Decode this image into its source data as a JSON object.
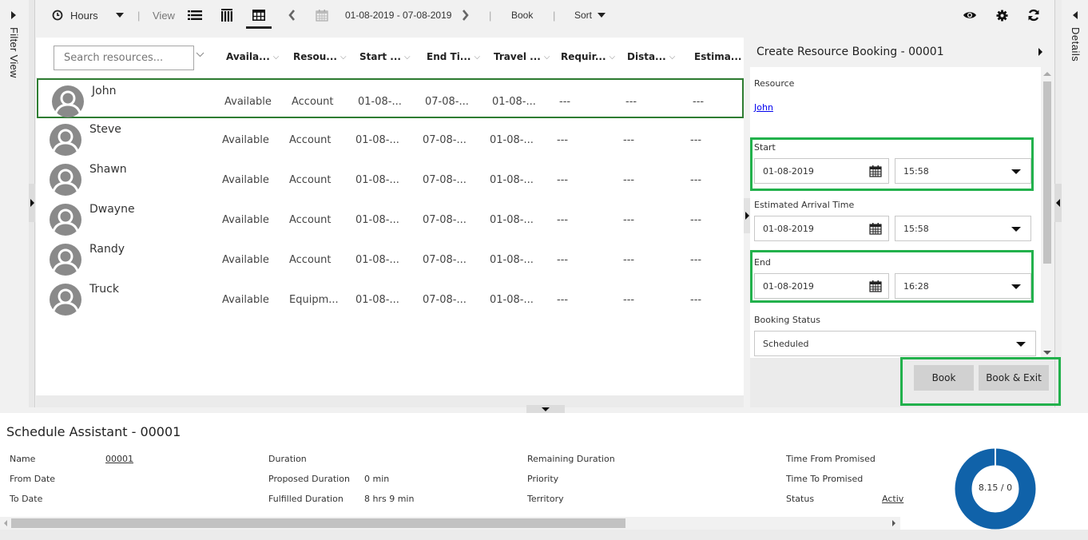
{
  "left_rail": {
    "label": "Filter View"
  },
  "right_rail": {
    "label": "Details"
  },
  "toolbar": {
    "time_scale": "Hours",
    "view_label": "View",
    "date_range": "01-08-2019 - 07-08-2019",
    "book_label": "Book",
    "sort_label": "Sort",
    "active_view": "grid"
  },
  "grid": {
    "search_placeholder": "Search resources...",
    "columns": [
      "Availa...",
      "Resou...",
      "Start ...",
      "End Ti...",
      "Travel ...",
      "Requir...",
      "Dista...",
      "Estima..."
    ],
    "rows": [
      {
        "name": "John",
        "availability": "Available",
        "resource_type": "Account",
        "start": "01-08-...",
        "end": "07-08-...",
        "travel": "01-08-...",
        "required": "---",
        "distance": "---",
        "estimated": "---",
        "selected": true
      },
      {
        "name": "Steve",
        "availability": "Available",
        "resource_type": "Account",
        "start": "01-08-...",
        "end": "07-08-...",
        "travel": "01-08-...",
        "required": "---",
        "distance": "---",
        "estimated": "---",
        "selected": false
      },
      {
        "name": "Shawn",
        "availability": "Available",
        "resource_type": "Account",
        "start": "01-08-...",
        "end": "07-08-...",
        "travel": "01-08-...",
        "required": "---",
        "distance": "---",
        "estimated": "---",
        "selected": false
      },
      {
        "name": "Dwayne",
        "availability": "Available",
        "resource_type": "Account",
        "start": "01-08-...",
        "end": "07-08-...",
        "travel": "01-08-...",
        "required": "---",
        "distance": "---",
        "estimated": "---",
        "selected": false
      },
      {
        "name": "Randy",
        "availability": "Available",
        "resource_type": "Account",
        "start": "01-08-...",
        "end": "07-08-...",
        "travel": "01-08-...",
        "required": "---",
        "distance": "---",
        "estimated": "---",
        "selected": false
      },
      {
        "name": "Truck",
        "availability": "Available",
        "resource_type": "Equipm...",
        "start": "01-08-...",
        "end": "07-08-...",
        "travel": "01-08-...",
        "required": "---",
        "distance": "---",
        "estimated": "---",
        "selected": false
      }
    ]
  },
  "booking": {
    "title": "Create Resource Booking - 00001",
    "resource_label": "Resource",
    "resource_value": "John",
    "start_label": "Start",
    "start_date": "01-08-2019",
    "start_time": "15:58",
    "eta_label": "Estimated Arrival Time",
    "eta_date": "01-08-2019",
    "eta_time": "15:58",
    "end_label": "End",
    "end_date": "01-08-2019",
    "end_time": "16:28",
    "status_label": "Booking Status",
    "status_value": "Scheduled",
    "book_button": "Book",
    "book_exit_button": "Book & Exit"
  },
  "schedule_assistant": {
    "title": "Schedule Assistant - 00001",
    "fields": {
      "name_label": "Name",
      "name_value": "00001",
      "from_date_label": "From Date",
      "to_date_label": "To Date",
      "duration_label": "Duration",
      "proposed_duration_label": "Proposed Duration",
      "proposed_duration_value": "0 min",
      "fulfilled_duration_label": "Fulfilled Duration",
      "fulfilled_duration_value": "8 hrs 9 min",
      "remaining_duration_label": "Remaining Duration",
      "priority_label": "Priority",
      "territory_label": "Territory",
      "time_from_promised_label": "Time From Promised",
      "time_to_promised_label": "Time To Promised",
      "status_label": "Status",
      "status_value": "Activ"
    },
    "donut": {
      "label": "8.15 / 0",
      "fulfilled": 8.15,
      "remaining": 0,
      "color": "#1062a9"
    }
  },
  "colors": {
    "highlight": "#22b14c",
    "selected_row": "#2e7d32",
    "donut": "#1062a9",
    "link": "#0000ee"
  }
}
